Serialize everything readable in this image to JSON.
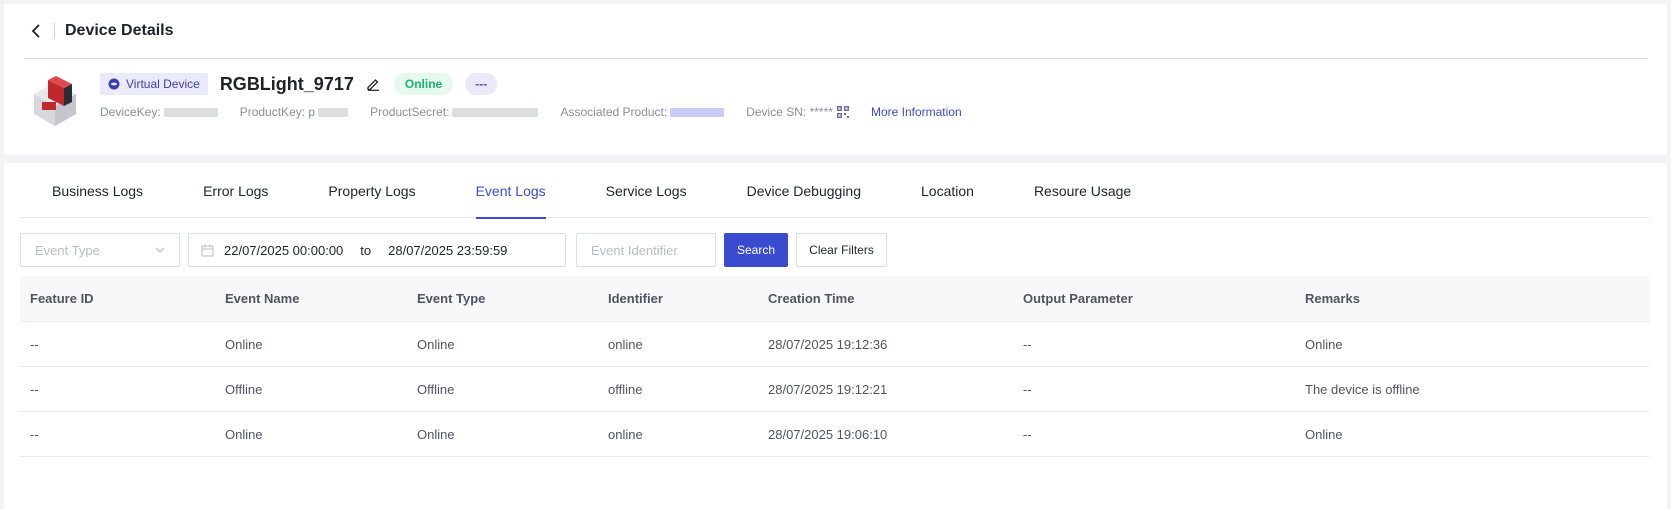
{
  "header": {
    "title": "Device Details"
  },
  "device": {
    "virtual_tag": "Virtual Device",
    "name": "RGBLight_9717",
    "status": "Online",
    "more_label": "---",
    "meta": {
      "device_key_label": "DeviceKey:",
      "product_key_label": "ProductKey:",
      "product_key_prefix": "p",
      "product_secret_label": "ProductSecret:",
      "associated_product_label": "Associated Product:",
      "device_sn_label": "Device SN:",
      "device_sn_value": "*****",
      "more_info_link": "More Information"
    }
  },
  "tabs": [
    {
      "label": "Business Logs"
    },
    {
      "label": "Error Logs"
    },
    {
      "label": "Property Logs"
    },
    {
      "label": "Event Logs"
    },
    {
      "label": "Service Logs"
    },
    {
      "label": "Device Debugging"
    },
    {
      "label": "Location"
    },
    {
      "label": "Resoure Usage"
    }
  ],
  "active_tab": "Event Logs",
  "filters": {
    "event_type_placeholder": "Event Type",
    "start_date": "22/07/2025 00:00:00",
    "to_label": "to",
    "end_date": "28/07/2025 23:59:59",
    "event_identifier_placeholder": "Event Identifier",
    "search_label": "Search",
    "clear_label": "Clear Filters"
  },
  "table": {
    "columns": [
      "Feature ID",
      "Event Name",
      "Event Type",
      "Identifier",
      "Creation Time",
      "Output Parameter",
      "Remarks"
    ],
    "rows": [
      [
        "--",
        "Online",
        "Online",
        "online",
        "28/07/2025 19:12:36",
        "--",
        "Online"
      ],
      [
        "--",
        "Offline",
        "Offline",
        "offline",
        "28/07/2025 19:12:21",
        "--",
        "The device is offline"
      ],
      [
        "--",
        "Online",
        "Online",
        "online",
        "28/07/2025 19:06:10",
        "--",
        "Online"
      ]
    ]
  },
  "colors": {
    "accent": "#3b4bd0",
    "online_green": "#1bb46b",
    "virtual_tag_bg": "#ebeafb"
  }
}
